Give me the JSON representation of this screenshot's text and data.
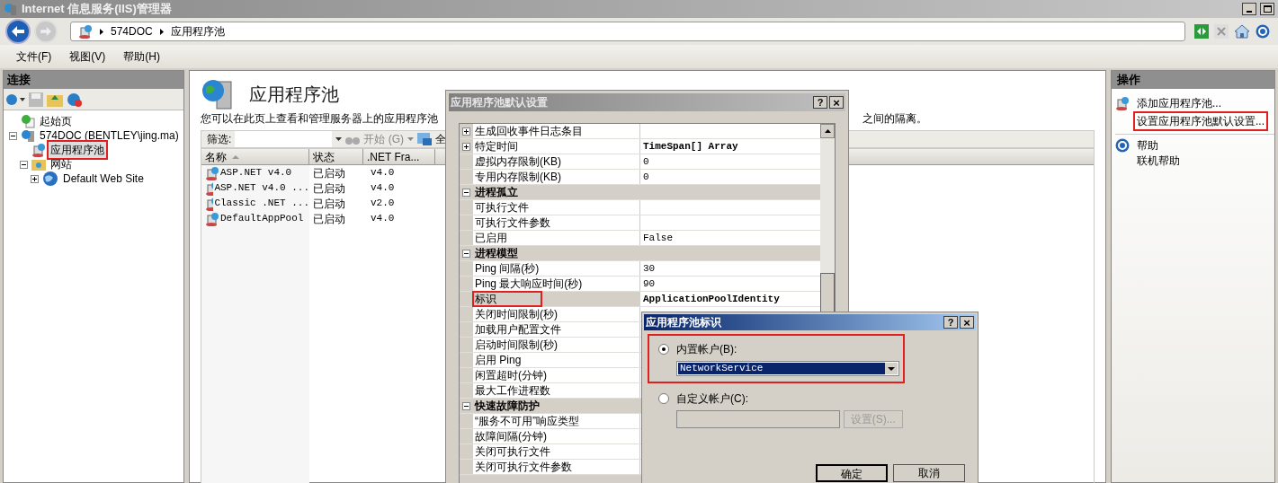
{
  "window": {
    "title": "Internet 信息服务(IIS)管理器"
  },
  "address_bar": {
    "crumbs": [
      "574DOC",
      "应用程序池"
    ]
  },
  "menu": [
    "文件(F)",
    "视图(V)",
    "帮助(H)"
  ],
  "connections": {
    "title": "连接",
    "tree": [
      {
        "label": "起始页",
        "kind": "start",
        "selected": false,
        "highlighted": false
      },
      {
        "label": "574DOC (BENTLEY\\jing.ma)",
        "kind": "server",
        "selected": false,
        "highlighted": false,
        "expanded": true,
        "children": [
          {
            "label": "应用程序池",
            "kind": "pool",
            "selected": true,
            "highlighted": true
          },
          {
            "label": "网站",
            "kind": "folder",
            "selected": false,
            "highlighted": false,
            "expanded": true,
            "children": [
              {
                "label": "Default Web Site",
                "kind": "site",
                "selected": false,
                "highlighted": false,
                "expanded": false
              }
            ]
          }
        ]
      }
    ]
  },
  "page": {
    "title": "应用程序池",
    "description": "您可以在此页上查看和管理服务器上的应用程序池",
    "description_tail": "之间的隔离。",
    "filter": {
      "label": "筛选:",
      "start": "开始 (G)",
      "show_all": "全"
    },
    "columns": [
      {
        "label": "名称",
        "sorted": true
      },
      {
        "label": "状态",
        "sorted": false
      },
      {
        "label": ".NET Fra...",
        "sorted": false
      }
    ],
    "rows": [
      {
        "name": "ASP.NET v4.0",
        "status": "已启动",
        "version": "v4.0"
      },
      {
        "name": "ASP.NET v4.0 ...",
        "status": "已启动",
        "version": "v4.0"
      },
      {
        "name": "Classic .NET ...",
        "status": "已启动",
        "version": "v2.0"
      },
      {
        "name": "DefaultAppPool",
        "status": "已启动",
        "version": "v4.0"
      }
    ]
  },
  "actions": {
    "title": "操作",
    "items": [
      {
        "label": "添加应用程序池...",
        "highlighted": false
      },
      {
        "label": "设置应用程序池默认设置...",
        "highlighted": true
      },
      {
        "label": "帮助",
        "highlighted": false
      },
      {
        "label": "联机帮助",
        "highlighted": false
      }
    ]
  },
  "defaults_dialog": {
    "title": "应用程序池默认设置",
    "help": "?",
    "close": "×",
    "rows": [
      {
        "kind": "property",
        "label": "生成回收事件日志条目",
        "expandable": true,
        "selected": false,
        "highlighted": false
      },
      {
        "kind": "property",
        "label": "特定时间",
        "value": "TimeSpan[] Array",
        "modified": true,
        "expandable": true,
        "selected": false,
        "highlighted": false
      },
      {
        "kind": "property",
        "label": "虚拟内存限制(KB)",
        "value": "0",
        "modified": false,
        "expandable": false,
        "selected": false,
        "highlighted": false
      },
      {
        "kind": "property",
        "label": "专用内存限制(KB)",
        "value": "0",
        "modified": false,
        "expandable": false,
        "selected": false,
        "highlighted": false
      },
      {
        "kind": "category",
        "label": "进程孤立",
        "expanded": true
      },
      {
        "kind": "property",
        "label": "可执行文件",
        "expandable": false,
        "selected": false,
        "highlighted": false
      },
      {
        "kind": "property",
        "label": "可执行文件参数",
        "expandable": false,
        "selected": false,
        "highlighted": false
      },
      {
        "kind": "property",
        "label": "已启用",
        "value": "False",
        "modified": false,
        "expandable": false,
        "selected": false,
        "highlighted": false
      },
      {
        "kind": "category",
        "label": "进程模型",
        "expanded": true
      },
      {
        "kind": "property",
        "label": "Ping 间隔(秒)",
        "value": "30",
        "modified": false,
        "expandable": false,
        "selected": false,
        "highlighted": false
      },
      {
        "kind": "property",
        "label": "Ping 最大响应时间(秒)",
        "value": "90",
        "modified": false,
        "expandable": false,
        "selected": false,
        "highlighted": false
      },
      {
        "kind": "property",
        "label": "标识",
        "value": "ApplicationPoolIdentity",
        "modified": true,
        "expandable": false,
        "selected": true,
        "highlighted": true
      },
      {
        "kind": "property",
        "label": "关闭时间限制(秒)",
        "expandable": false,
        "selected": false,
        "highlighted": false
      },
      {
        "kind": "property",
        "label": "加载用户配置文件",
        "expandable": false,
        "selected": false,
        "highlighted": false
      },
      {
        "kind": "property",
        "label": "启动时间限制(秒)",
        "expandable": false,
        "selected": false,
        "highlighted": false
      },
      {
        "kind": "property",
        "label": "启用 Ping",
        "expandable": false,
        "selected": false,
        "highlighted": false
      },
      {
        "kind": "property",
        "label": "闲置超时(分钟)",
        "expandable": false,
        "selected": false,
        "highlighted": false
      },
      {
        "kind": "property",
        "label": "最大工作进程数",
        "expandable": false,
        "selected": false,
        "highlighted": false
      },
      {
        "kind": "category",
        "label": "快速故障防护",
        "expanded": true
      },
      {
        "kind": "property",
        "label": "“服务不可用”响应类型",
        "expandable": false,
        "selected": false,
        "highlighted": false
      },
      {
        "kind": "property",
        "label": "故障间隔(分钟)",
        "expandable": false,
        "selected": false,
        "highlighted": false
      },
      {
        "kind": "property",
        "label": "关闭可执行文件",
        "expandable": false,
        "selected": false,
        "highlighted": false
      },
      {
        "kind": "property",
        "label": "关闭可执行文件参数",
        "expandable": false,
        "selected": false,
        "highlighted": false
      }
    ]
  },
  "identity_dialog": {
    "title": "应用程序池标识",
    "help": "?",
    "close": "×",
    "options": [
      {
        "label": "内置帐户(B):",
        "selected": true,
        "highlighted": true,
        "kind": "combo",
        "value": "NetworkService"
      },
      {
        "label": "自定义帐户(C):",
        "selected": false,
        "highlighted": false,
        "kind": "text",
        "button": "设置(S)..."
      }
    ],
    "buttons": [
      "确定",
      "取消"
    ]
  }
}
